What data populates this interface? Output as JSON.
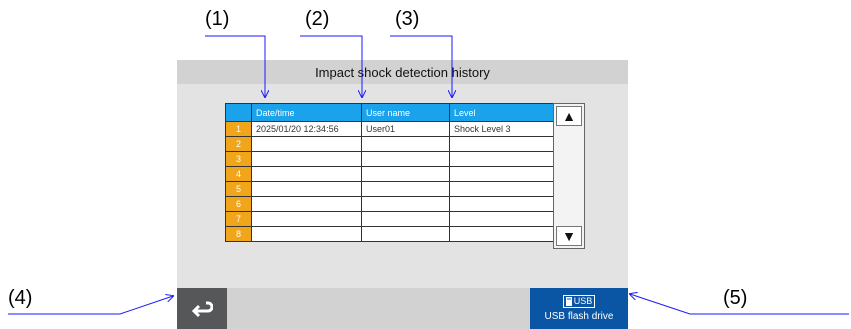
{
  "callouts": [
    "(1)",
    "(2)",
    "(3)",
    "(4)",
    "(5)"
  ],
  "screen": {
    "title": "Impact shock detection history",
    "columns": [
      "Date/time",
      "User name",
      "Level"
    ],
    "rows": [
      {
        "num": "1",
        "datetime": "2025/01/20   12:34:56",
        "user": "User01",
        "level": "Shock Level 3"
      },
      {
        "num": "2",
        "datetime": "",
        "user": "",
        "level": ""
      },
      {
        "num": "3",
        "datetime": "",
        "user": "",
        "level": ""
      },
      {
        "num": "4",
        "datetime": "",
        "user": "",
        "level": ""
      },
      {
        "num": "5",
        "datetime": "",
        "user": "",
        "level": ""
      },
      {
        "num": "6",
        "datetime": "",
        "user": "",
        "level": ""
      },
      {
        "num": "7",
        "datetime": "",
        "user": "",
        "level": ""
      },
      {
        "num": "8",
        "datetime": "",
        "user": "",
        "level": ""
      }
    ],
    "scroll_up_symbol": "▲",
    "scroll_down_symbol": "▼",
    "usb_tag": "USB",
    "usb_label": "USB flash drive"
  },
  "colors": {
    "header_blue": "#1aa3ea",
    "row_number_orange": "#f0a51a",
    "usb_button_blue": "#0b55a5",
    "back_button_gray": "#555759",
    "callout_line_blue": "#1a1aff"
  },
  "icons": {
    "back": "return-arrow-icon",
    "usb": "usb-drive-icon",
    "scroll_up": "triangle-up-icon",
    "scroll_down": "triangle-down-icon"
  }
}
